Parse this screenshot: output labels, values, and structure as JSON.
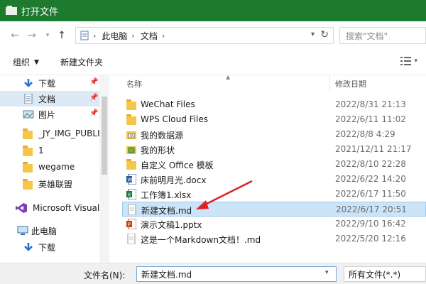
{
  "window": {
    "title": "打开文件",
    "titlebar_color": "#1e7a2f"
  },
  "nav": {
    "address": {
      "crumbs": [
        "此电脑",
        "文档"
      ]
    },
    "search_placeholder": "搜索\"文档\""
  },
  "toolbar": {
    "organize_label": "组织",
    "new_folder_label": "新建文件夹"
  },
  "sidebar": {
    "items": [
      {
        "label": "下载",
        "icon": "download-icon",
        "pinned": true
      },
      {
        "label": "文档",
        "icon": "document-icon",
        "pinned": true,
        "selected": true
      },
      {
        "label": "图片",
        "icon": "picture-icon",
        "pinned": true
      },
      {
        "label": "_JY_IMG_PUBLI",
        "icon": "folder-icon"
      },
      {
        "label": "1",
        "icon": "folder-icon"
      },
      {
        "label": "wegame",
        "icon": "folder-icon"
      },
      {
        "label": "英雄联盟",
        "icon": "folder-icon"
      },
      {
        "label": "Microsoft Visual",
        "icon": "visual-studio-icon"
      },
      {
        "label": "此电脑",
        "icon": "computer-icon"
      },
      {
        "label": "下载",
        "icon": "download-icon"
      }
    ]
  },
  "list": {
    "columns": {
      "name": "名称",
      "date": "修改日期"
    },
    "rows": [
      {
        "name": "WeChat Files",
        "date": "2022/8/31 21:13",
        "type": "folder"
      },
      {
        "name": "WPS Cloud Files",
        "date": "2022/6/11 11:02",
        "type": "folder"
      },
      {
        "name": "我的数据源",
        "date": "2022/8/8 4:29",
        "type": "datasource"
      },
      {
        "name": "我的形状",
        "date": "2021/12/11 21:17",
        "type": "shapes"
      },
      {
        "name": "自定义 Office 模板",
        "date": "2022/8/10 22:28",
        "type": "folder"
      },
      {
        "name": "床前明月光.docx",
        "date": "2022/6/22 14:20",
        "type": "docx"
      },
      {
        "name": "工作簿1.xlsx",
        "date": "2022/6/17 11:50",
        "type": "xlsx"
      },
      {
        "name": "新建文档.md",
        "date": "2022/6/17 20:51",
        "type": "md",
        "selected": true
      },
      {
        "name": "演示文稿1.pptx",
        "date": "2022/9/10 16:42",
        "type": "pptx"
      },
      {
        "name": "这是一个Markdown文档！.md",
        "date": "2022/5/20 12:16",
        "type": "md"
      }
    ]
  },
  "bottom": {
    "filename_label": "文件名(N):",
    "filename_value": "新建文档.md",
    "filter_value": "所有文件(*.*)"
  },
  "colors": {
    "selection": "#cce4f7",
    "annotation_arrow": "#e02020"
  }
}
